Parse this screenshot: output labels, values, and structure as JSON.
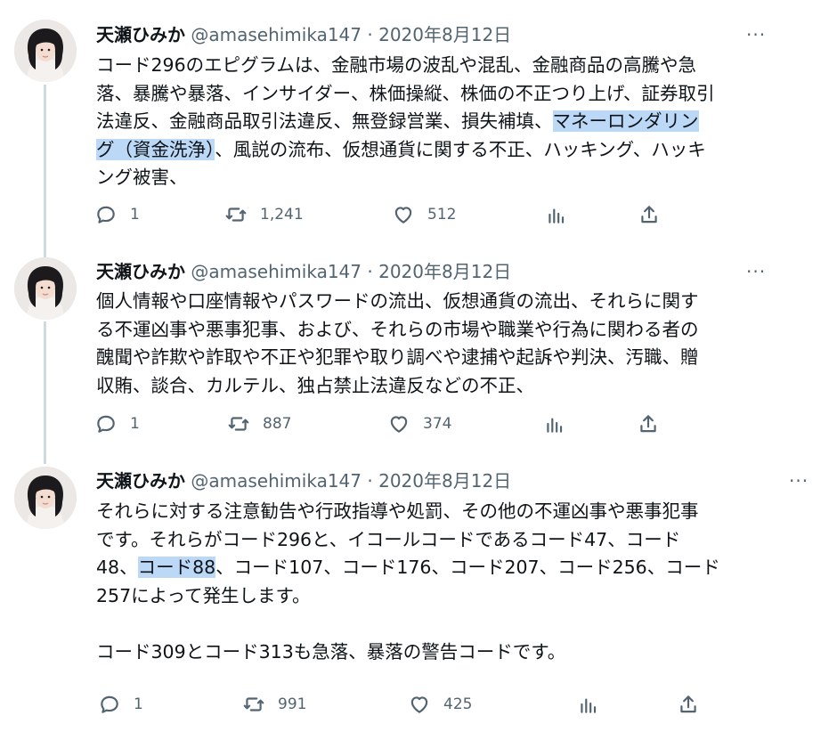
{
  "tweets": [
    {
      "name": "天瀬ひみか",
      "handle": "@amasehimika147",
      "sep": " · ",
      "date": "2020年8月12日",
      "more": "···",
      "lines": [
        [
          {
            "t": "コード296のエピグラムは、金融市場の波乱や混乱、金融商品の高騰や急"
          }
        ],
        [
          {
            "t": "落、暴騰や暴落、インサイダー、株価操縦、株価の不正つり上げ、証券取引"
          }
        ],
        [
          {
            "t": "法違反、金融商品取引法違反、無登録営業、損失補填、"
          },
          {
            "t": "マネーロンダリン",
            "hl": true
          }
        ],
        [
          {
            "t": "グ（資金洗浄）",
            "hl": true
          },
          {
            "t": "、風説の流布、仮想通貨に関する不正、ハッキング、ハッキ"
          }
        ],
        [
          {
            "t": "ング被害、"
          }
        ]
      ],
      "reply": "1",
      "retweet": "1,241",
      "like": "512"
    },
    {
      "name": "天瀬ひみか",
      "handle": "@amasehimika147",
      "sep": " · ",
      "date": "2020年8月12日",
      "more": "···",
      "lines": [
        [
          {
            "t": "個人情報や口座情報やパスワードの流出、仮想通貨の流出、それらに関す"
          }
        ],
        [
          {
            "t": "る不運凶事や悪事犯事、および、それらの市場や職業や行為に関わる者の"
          }
        ],
        [
          {
            "t": "醜聞や詐欺や詐取や不正や犯罪や取り調べや逮捕や起訴や判決、汚職、贈"
          }
        ],
        [
          {
            "t": "収賄、談合、カルテル、独占禁止法違反などの不正、"
          }
        ]
      ],
      "reply": "1",
      "retweet": "887",
      "like": "374"
    },
    {
      "name": "天瀬ひみか",
      "handle": "@amasehimika147",
      "sep": " · ",
      "date": "2020年8月12日",
      "more": "···",
      "lines": [
        [
          {
            "t": "それらに対する注意勧告や行政指導や処罰、その他の不運凶事や悪事犯事"
          }
        ],
        [
          {
            "t": "です。それらがコード296と、イコールコードであるコード47、コード"
          }
        ],
        [
          {
            "t": "48、"
          },
          {
            "t": "コード88",
            "hl": true
          },
          {
            "t": "、コード107、コード176、コード207、コード256、コード"
          }
        ],
        [
          {
            "t": "257によって発生します。"
          }
        ],
        [],
        [
          {
            "t": "コード309とコード313も急落、暴落の警告コードです。"
          }
        ]
      ],
      "reply": "1",
      "retweet": "991",
      "like": "425"
    }
  ],
  "colors": {
    "text": "#0f1419",
    "secondary": "#536471",
    "highlight": "#bcd8f7",
    "thread_line": "#cfd9de"
  },
  "icons": [
    "reply-icon",
    "retweet-icon",
    "like-icon",
    "analytics-icon",
    "share-icon"
  ]
}
